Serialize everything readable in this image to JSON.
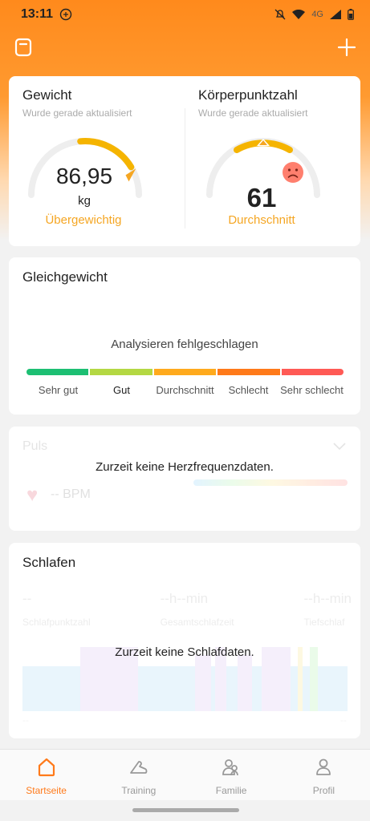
{
  "status_bar": {
    "time": "13:11",
    "network": "4G"
  },
  "colors": {
    "accent": "#ff7a1a",
    "status_warning": "#f5a623",
    "gauge_track": "#eeeeee"
  },
  "weight": {
    "title": "Gewicht",
    "subtitle": "Wurde gerade aktualisiert",
    "value": "86,95",
    "unit": "kg",
    "status": "Übergewichtig",
    "gauge_level": 0.78
  },
  "body_score": {
    "title": "Körperpunktzahl",
    "subtitle": "Wurde gerade aktualisiert",
    "value": "61",
    "status": "Durchschnitt",
    "face_icon": "sad-face-icon"
  },
  "balance": {
    "title": "Gleichgewicht",
    "message": "Analysieren fehlgeschlagen",
    "segments": [
      {
        "label": "Sehr gut",
        "color": "#1dbf73"
      },
      {
        "label": "Gut",
        "color": "#b4d843"
      },
      {
        "label": "Durchschnitt",
        "color": "#ffaa1d"
      },
      {
        "label": "Schlecht",
        "color": "#ff7a1a"
      },
      {
        "label": "Sehr schlecht",
        "color": "#ff5a55"
      }
    ]
  },
  "pulse": {
    "title": "Puls",
    "value": "--",
    "unit": "BPM",
    "empty_message": "Zurzeit keine Herzfrequenzdaten."
  },
  "sleep": {
    "title": "Schlafen",
    "empty_message": "Zurzeit keine Schlafdaten.",
    "stats": [
      {
        "value": "--",
        "label": "Schlafpunktzahl"
      },
      {
        "value": "--h--min",
        "label": "Gesamtschlafzeit"
      },
      {
        "value": "--h--min",
        "label": "Tiefschlaf"
      }
    ],
    "axis_start": "--",
    "axis_end": "--"
  },
  "nav": {
    "items": [
      {
        "label": "Startseite",
        "icon": "home-icon",
        "active": true
      },
      {
        "label": "Training",
        "icon": "shoe-icon",
        "active": false
      },
      {
        "label": "Familie",
        "icon": "family-icon",
        "active": false
      },
      {
        "label": "Profil",
        "icon": "profile-icon",
        "active": false
      }
    ]
  }
}
